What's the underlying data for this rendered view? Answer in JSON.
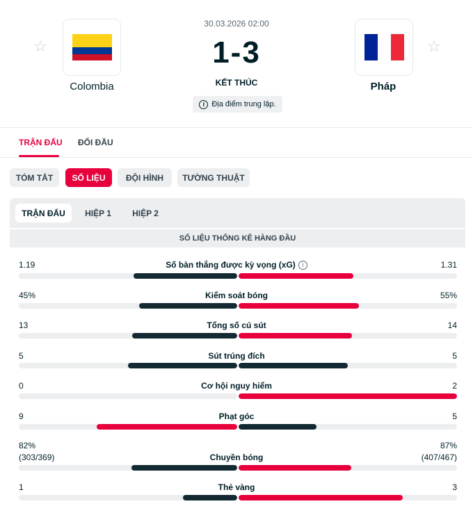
{
  "match": {
    "date": "30.03.2026 02:00",
    "score": "1-3",
    "status": "KẾT THÚC",
    "venue_note": "Địa điểm trung lập."
  },
  "home": {
    "name": "Colombia",
    "flag_colors": [
      "#fcd116",
      "#003893",
      "#ce1126"
    ]
  },
  "away": {
    "name": "Pháp",
    "flag_colors": [
      "#002395",
      "#ffffff",
      "#ed2939"
    ]
  },
  "icons": {
    "favorite": "star-icon",
    "info": "info-icon"
  },
  "colors": {
    "accent": "#e8003d",
    "home_bar": "#132a33",
    "track": "#eceef0"
  },
  "main_tabs": [
    {
      "label": "TRẬN ĐẤU",
      "active": true
    },
    {
      "label": "ĐỐI ĐẦU",
      "active": false
    }
  ],
  "sub_tabs": [
    {
      "label": "TÓM TẮT",
      "active": false
    },
    {
      "label": "SỐ LIỆU",
      "active": true
    },
    {
      "label": "ĐỘI HÌNH",
      "active": false
    },
    {
      "label": "TƯỜNG THUẬT",
      "active": false
    }
  ],
  "periods": [
    {
      "label": "TRẬN ĐẤU",
      "active": true
    },
    {
      "label": "HIỆP 1",
      "active": false
    },
    {
      "label": "HIỆP 2",
      "active": false
    }
  ],
  "section_title": "SỐ LIỆU THỐNG KÊ HÀNG ĐẦU",
  "stats": [
    {
      "label": "Số bàn thắng được kỳ vọng (xG)",
      "home": "1.19",
      "away": "1.31",
      "home_share": 0.476,
      "away_share": 0.524,
      "info": true
    },
    {
      "label": "Kiểm soát bóng",
      "home": "45%",
      "away": "55%",
      "home_share": 0.45,
      "away_share": 0.55
    },
    {
      "label": "Tổng số cú sút",
      "home": "13",
      "away": "14",
      "home_share": 0.481,
      "away_share": 0.519
    },
    {
      "label": "Sút trúng đích",
      "home": "5",
      "away": "5",
      "home_share": 0.5,
      "away_share": 0.5
    },
    {
      "label": "Cơ hội nguy hiểm",
      "home": "0",
      "away": "2",
      "home_share": 0.0,
      "away_share": 1.0
    },
    {
      "label": "Phạt góc",
      "home": "9",
      "away": "5",
      "home_share": 0.643,
      "away_share": 0.357
    },
    {
      "label": "Chuyền bóng",
      "home": "82%",
      "away": "87%",
      "home_sub": "(303/369)",
      "away_sub": "(407/467)",
      "home_share": 0.485,
      "away_share": 0.515
    },
    {
      "label": "Thẻ vàng",
      "home": "1",
      "away": "3",
      "home_share": 0.25,
      "away_share": 0.75
    }
  ]
}
